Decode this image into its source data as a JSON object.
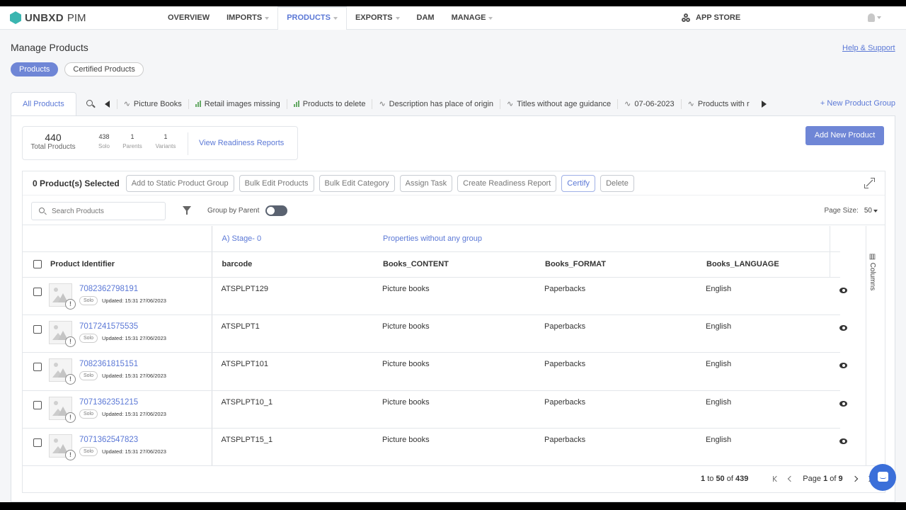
{
  "brand": {
    "name": "UNBXD",
    "product": "PIM"
  },
  "nav": {
    "items": [
      {
        "label": "OVERVIEW",
        "dropdown": false
      },
      {
        "label": "IMPORTS",
        "dropdown": true
      },
      {
        "label": "PRODUCTS",
        "dropdown": true,
        "active": true
      },
      {
        "label": "EXPORTS",
        "dropdown": true
      },
      {
        "label": "DAM",
        "dropdown": false
      },
      {
        "label": "MANAGE",
        "dropdown": true
      }
    ],
    "app_store": "APP STORE"
  },
  "page": {
    "title": "Manage Products",
    "help_link": "Help & Support"
  },
  "pills": {
    "products": "Products",
    "certified": "Certified Products"
  },
  "tabs": {
    "first": "All Products",
    "groups": [
      {
        "label": "Picture Books",
        "icon": "pulse-icon"
      },
      {
        "label": "Retail images missing",
        "icon": "bar-chart-icon"
      },
      {
        "label": "Products to delete",
        "icon": "bar-chart-icon"
      },
      {
        "label": "Description has place of origin",
        "icon": "pulse-icon"
      },
      {
        "label": "Titles without age guidance",
        "icon": "pulse-icon"
      },
      {
        "label": "07-06-2023",
        "icon": "pulse-icon"
      },
      {
        "label": "Products with r",
        "icon": "pulse-icon"
      }
    ],
    "new_group": "+ New Product Group"
  },
  "stats": {
    "total": "440",
    "total_label": "Total Products",
    "solo": "438",
    "solo_label": "Solo",
    "parents": "1",
    "parents_label": "Parents",
    "variants": "1",
    "variants_label": "Variants",
    "view_reports": "View Readiness Reports"
  },
  "add_new": "Add New Product",
  "actions": {
    "selected": "0 Product(s) Selected",
    "buttons": [
      "Add to Static Product Group",
      "Bulk Edit Products",
      "Bulk Edit Category",
      "Assign Task",
      "Create Readiness Report",
      "Certify",
      "Delete"
    ]
  },
  "search": {
    "placeholder": "Search Products"
  },
  "group_by_parent": "Group by Parent",
  "page_size": {
    "label": "Page Size:",
    "value": "50"
  },
  "table": {
    "group_headers": {
      "stage": "A) Stage- 0",
      "props": "Properties without any group"
    },
    "headers": {
      "id": "Product Identifier",
      "barcode": "barcode",
      "content": "Books_CONTENT",
      "format": "Books_FORMAT",
      "language": "Books_LANGUAGE"
    },
    "columns_label": "Columns",
    "rows": [
      {
        "id": "7082362798191",
        "type": "Solo",
        "updated": "Updated: 15:31 27/06/2023",
        "barcode": "ATSPLPT129",
        "content": "Picture books",
        "format": "Paperbacks",
        "language": "English"
      },
      {
        "id": "7017241575535",
        "type": "Solo",
        "updated": "Updated: 15:31 27/06/2023",
        "barcode": "ATSPLPT1",
        "content": "Picture books",
        "format": "Paperbacks",
        "language": "English"
      },
      {
        "id": "7082361815151",
        "type": "Solo",
        "updated": "Updated: 15:31 27/06/2023",
        "barcode": "ATSPLPT101",
        "content": "Picture books",
        "format": "Paperbacks",
        "language": "English"
      },
      {
        "id": "7071362351215",
        "type": "Solo",
        "updated": "Updated: 15:31 27/06/2023",
        "barcode": "ATSPLPT10_1",
        "content": "Picture books",
        "format": "Paperbacks",
        "language": "English"
      },
      {
        "id": "7071362547823",
        "type": "Solo",
        "updated": "Updated: 15:31 27/06/2023",
        "barcode": "ATSPLPT15_1",
        "content": "Picture books",
        "format": "Paperbacks",
        "language": "English"
      }
    ]
  },
  "pagination": {
    "from": "1",
    "to_word": "to",
    "to": "50",
    "of_word": "of",
    "total": "439",
    "page_word": "Page",
    "page": "1",
    "page_of": "of",
    "pages": "9"
  },
  "colors": {
    "accent": "#5b78d6",
    "button": "#6f86d6",
    "brand": "#3ab5b0"
  }
}
